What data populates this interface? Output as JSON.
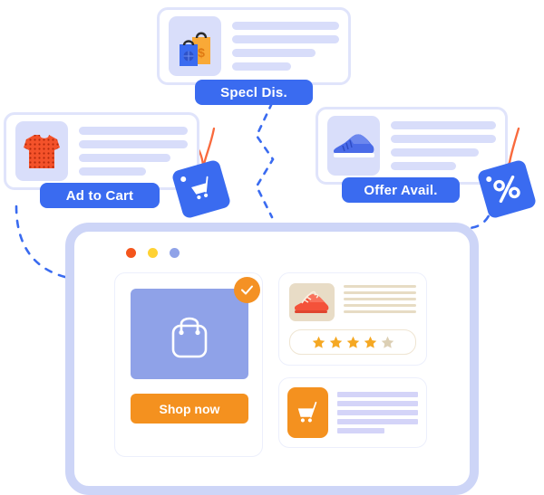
{
  "illustration": {
    "title": "E-commerce promotion flow illustration",
    "colors": {
      "brand_blue": "#3A6BF0",
      "card_border_lavender": "#E0E4FB",
      "text_line_lavender": "#D8DDFA",
      "orange_accent": "#F4911F",
      "periwinkle": "#8FA2E8",
      "string_orange": "#F96A3D",
      "star_gold": "#F5A823",
      "star_empty": "#DCCFB4",
      "beige": "#E8DCC6",
      "browser_frame": "#CDD5F7"
    }
  },
  "cards": [
    {
      "id": "special-discount",
      "icon": "shopping-bags-icon",
      "label": "Specl Dis.",
      "text_lines": [
        100,
        100,
        78,
        55
      ]
    },
    {
      "id": "add-to-cart",
      "icon": "tshirt-icon",
      "label": "Ad to Cart",
      "tag_icon": "shopping-cart-icon",
      "text_lines": [
        100,
        100,
        84,
        62
      ]
    },
    {
      "id": "offer-available",
      "icon": "sneaker-icon",
      "label": "Offer Avail.",
      "tag_icon": "percent-icon",
      "text_lines": [
        100,
        100,
        84,
        62
      ]
    }
  ],
  "browser": {
    "traffic_lights": [
      {
        "name": "close-dot",
        "color": "#F4551C"
      },
      {
        "name": "minimize-dot",
        "color": "#FFD233"
      },
      {
        "name": "maximize-dot",
        "color": "#8FA2E8"
      }
    ],
    "promo_panel": {
      "hero_icon": "shopping-bag-icon",
      "badge_icon": "check-icon",
      "cta_label": "Shop now"
    },
    "review_panel": {
      "product_icon": "red-sneaker-icon",
      "text_lines": [
        100,
        100,
        100,
        100,
        100
      ],
      "rating": 4,
      "max_rating": 5,
      "star_icon": "star-icon"
    },
    "cart_panel": {
      "icon": "shopping-cart-icon",
      "text_lines": [
        100,
        100,
        100,
        100,
        58
      ]
    }
  }
}
